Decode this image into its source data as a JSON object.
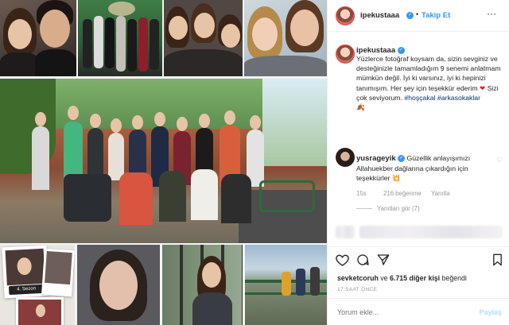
{
  "post": {
    "username": "ipekustaaa",
    "follow_label": "Takip Et",
    "caption_user": "ipekustaaa",
    "caption_text": "Yüzlerce fotoğraf koysam da, sizin sevginiz ve desteğinizle tamamladığım 9 senemi anlatmam mümkün değil. İyi ki varsınız, iyi ki hepinizi tanımışım. Her şey için teşekkür ederim",
    "caption_text2": "Sizi çok seviyorum.",
    "hashtag1": "#hoşçakal",
    "hashtag2": "#arkasokaklar",
    "caption_emoji": "🍂"
  },
  "comment": {
    "username": "yusrageyik",
    "text": "Güzellik anlayışımızı Allahuekber dağlarına çıkardığın için teşekkürler",
    "emoji": "💥",
    "time": "15s",
    "likes": "216 beğenme",
    "reply": "Yanıtla",
    "view_replies": "Yanıtları gör (7)"
  },
  "footer": {
    "likes_user": "sevketcoruh",
    "likes_conj": "ve",
    "likes_count": "6.715 diğer kişi",
    "likes_suffix": "beğendi",
    "time_ago": "17 SAAT ÖNCE",
    "comment_placeholder": "Yorum ekle...",
    "post_label": "Paylaş"
  },
  "collage": {
    "badge_text": "4. Sezon"
  }
}
